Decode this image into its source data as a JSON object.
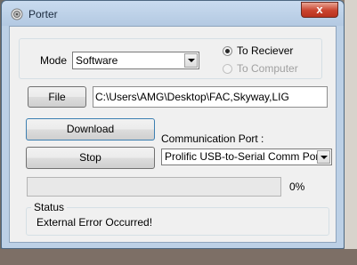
{
  "window": {
    "title": "Porter",
    "close_label": "x"
  },
  "mode": {
    "label": "Mode",
    "selected": "Software",
    "radios": [
      {
        "label": "To Reciever",
        "checked": true,
        "enabled": true
      },
      {
        "label": "To Computer",
        "checked": false,
        "enabled": false
      }
    ]
  },
  "file": {
    "button_label": "File",
    "path": "C:\\Users\\AMG\\Desktop\\FAC,Skyway,LIG"
  },
  "actions": {
    "download_label": "Download",
    "stop_label": "Stop"
  },
  "comm": {
    "label": "Communication Port :",
    "selected": "Prolific USB-to-Serial Comm Port"
  },
  "progress": {
    "value": 0,
    "text": "0%"
  },
  "status": {
    "label": "Status",
    "message": "External Error Occurred!"
  },
  "colors": {
    "title_bar": "#bcd0e6",
    "close_button": "#c9432e",
    "progress_fill": "#06b025"
  },
  "icons": {
    "app": "porter-app-icon",
    "combo": "chevron-down-icon"
  }
}
